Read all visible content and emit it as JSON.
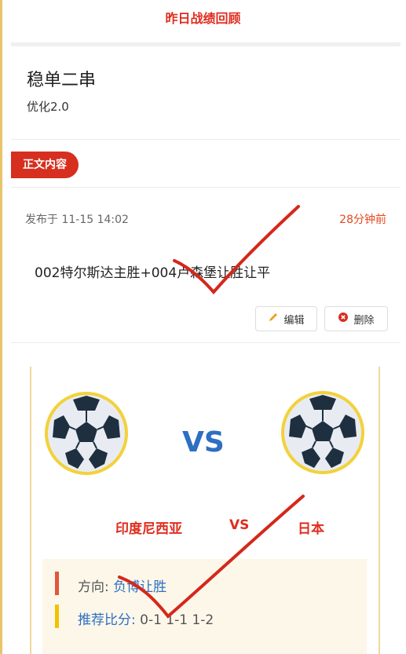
{
  "header": {
    "title": "昨日战绩回顾"
  },
  "card": {
    "title": "稳单二串",
    "subtitle": "优化2.0"
  },
  "tag": {
    "label": "正文内容"
  },
  "meta": {
    "published": "发布于 11-15 14:02",
    "ago": "28分钟前"
  },
  "post": {
    "text": "002特尔斯达主胜+004卢森堡让胜让平"
  },
  "actions": {
    "edit_label": "编辑",
    "delete_label": "删除"
  },
  "match": {
    "vs_big": "VS",
    "home_team": "印度尼西亚",
    "vs_small": "VS",
    "away_team": "日本"
  },
  "tips": {
    "direction_label": "方向:",
    "direction_value": " 负博让胜",
    "score_label": "推荐比分:",
    "score_value": " 0-1 1-1 1-2"
  },
  "colors": {
    "accent": "#e02d1f",
    "blue": "#2d6fc2",
    "panel_border": "#f0d89c",
    "tip_bg": "#fdf7ea"
  }
}
